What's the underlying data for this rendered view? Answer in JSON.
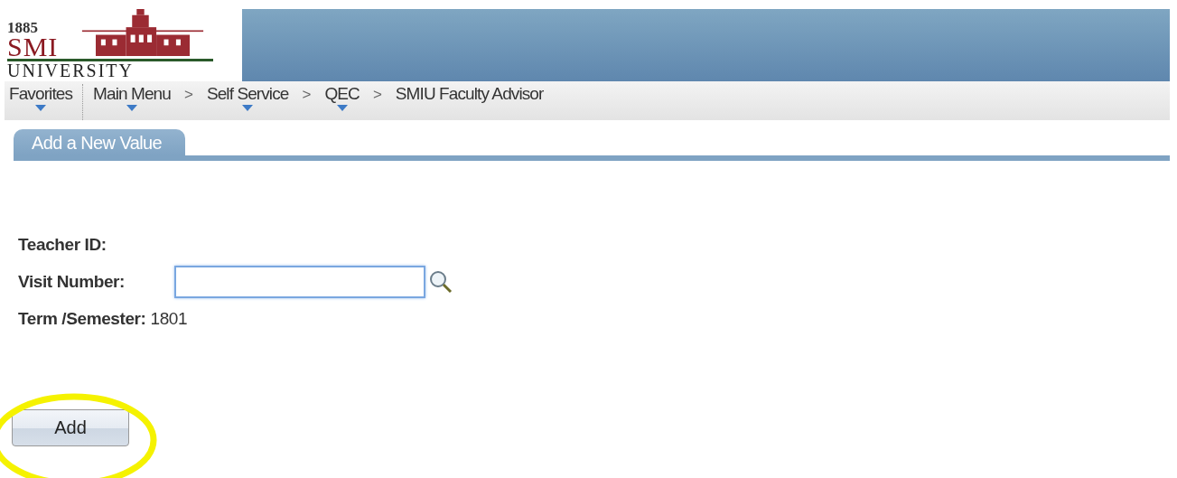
{
  "logo": {
    "year": "1885",
    "name": "SMI",
    "subtitle": "UNIVERSITY"
  },
  "nav": [
    {
      "label": "Favorites",
      "has_menu": true,
      "divider": true
    },
    {
      "label": "Main Menu",
      "has_menu": true,
      "separator": ">"
    },
    {
      "label": "Self Service",
      "has_menu": true,
      "separator": ">"
    },
    {
      "label": "QEC",
      "has_menu": true,
      "separator": ">"
    },
    {
      "label": "SMIU Faculty Advisor",
      "has_menu": false
    }
  ],
  "tabs": [
    {
      "label": "Add a New Value",
      "selected": true
    }
  ],
  "form": [
    {
      "kind": "text",
      "label": "Teacher ID:"
    },
    {
      "kind": "input",
      "label": "Visit Number:",
      "focused": true
    },
    {
      "kind": "text",
      "label": "Term /Semester:",
      "value": "1801"
    }
  ],
  "buttons": [
    {
      "label": "Add",
      "highlighted": true
    }
  ]
}
